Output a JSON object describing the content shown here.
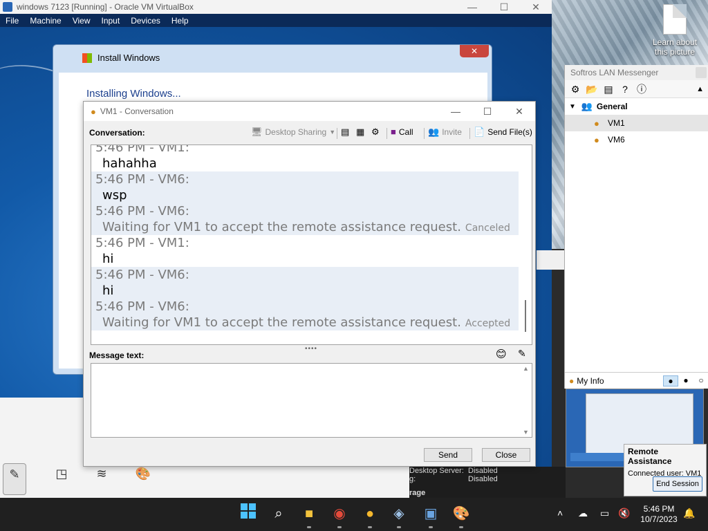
{
  "vbox": {
    "title": "windows 7123 [Running] - Oracle VM VirtualBox",
    "menu": [
      "File",
      "Machine",
      "View",
      "Input",
      "Devices",
      "Help"
    ]
  },
  "desktop_icon": {
    "label": "Learn about this picture"
  },
  "install": {
    "title": "Install Windows",
    "heading": "Installing Windows...",
    "close": "✕"
  },
  "conversation": {
    "title": "VM1 - Conversation",
    "conversation_label": "Conversation:",
    "toolbar": {
      "desktop_sharing": "Desktop Sharing",
      "call": "Call",
      "invite": "Invite",
      "send_files": "Send File(s)"
    },
    "messages": [
      {
        "header": "5:46 PM - VM1:",
        "text": "hahahha",
        "status": "",
        "system": false,
        "alt": false
      },
      {
        "header": "5:46 PM - VM6:",
        "text": "wsp",
        "status": "",
        "system": false,
        "alt": true
      },
      {
        "header": "5:46 PM - VM6:",
        "text": "Waiting for VM1 to accept the remote assistance request.",
        "status": "Canceled",
        "system": true,
        "alt": true
      },
      {
        "header": "5:46 PM - VM1:",
        "text": "hi",
        "status": "",
        "system": false,
        "alt": false
      },
      {
        "header": "5:46 PM - VM6:",
        "text": "hi",
        "status": "",
        "system": false,
        "alt": true
      },
      {
        "header": "5:46 PM - VM6:",
        "text": "Waiting for VM1 to accept the remote assistance request.",
        "status": "Accepted",
        "system": true,
        "alt": true
      }
    ],
    "message_label": "Message text:",
    "message_value": "",
    "send": "Send",
    "close": "Close"
  },
  "messenger": {
    "title": "Softros LAN Messenger",
    "group": "General",
    "contacts": [
      "VM1",
      "VM6"
    ],
    "selected": "VM1",
    "my_info": "My Info"
  },
  "guest_bottom": {
    "rows": [
      {
        "label": "Desktop Server:",
        "value": "Disabled"
      },
      {
        "label": "g:",
        "value": "Disabled"
      }
    ],
    "section": "rage"
  },
  "remote_assistance": {
    "title": "Remote Assistance",
    "connected": "Connected user:  VM1",
    "end_session": "End Session"
  },
  "taskbar": {
    "time": "5:46 PM",
    "date": "10/7/2023"
  }
}
